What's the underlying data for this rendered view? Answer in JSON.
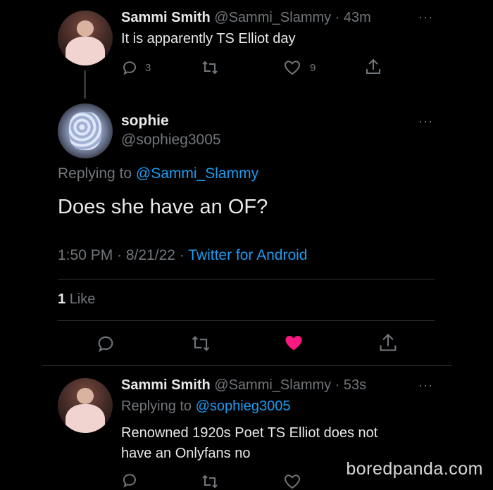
{
  "tweet1": {
    "name": "Sammi Smith",
    "handle": "@Sammi_Slammy",
    "time": "· 43m",
    "text": "It is apparently TS Elliot day",
    "replies": "3",
    "likes": "9",
    "more": "···"
  },
  "tweet2": {
    "name": "sophie",
    "handle": "@sophieg3005",
    "replying_prefix": "Replying to",
    "replying_handle": "@Sammi_Slammy",
    "text": "Does she have an OF?",
    "datetime": "1:50 PM · 8/21/22 ·",
    "source": "Twitter for Android",
    "like_count": "1",
    "like_label": "Like",
    "more": "···"
  },
  "tweet3": {
    "name": "Sammi Smith",
    "handle": "@Sammi_Slammy",
    "time": "· 53s",
    "replying_prefix": "Replying to",
    "replying_handle": "@sophieg3005",
    "text_line1": "Renowned 1920s Poet TS Elliot does not",
    "text_line2": "have an Onlyfans no",
    "more": "···"
  },
  "watermark": "boredpanda.com",
  "colors": {
    "background": "#000000",
    "text": "#e7e9ea",
    "muted": "#71767b",
    "link": "#1d9bf0",
    "like_active": "#f91880"
  }
}
